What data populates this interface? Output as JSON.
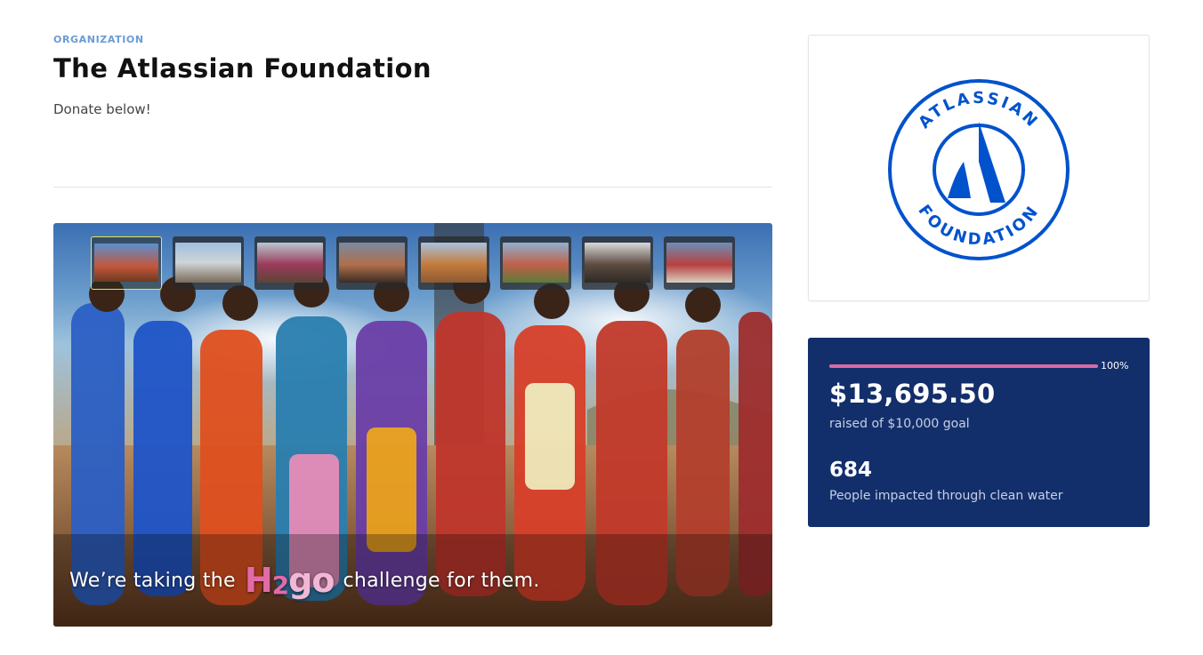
{
  "header": {
    "eyebrow": "ORGANIZATION",
    "title": "The Atlassian Foundation",
    "subtitle": "Donate below!"
  },
  "media": {
    "caption_prefix": "We’re taking the",
    "brand_h": "H",
    "brand_2": "2",
    "brand_g": "go",
    "caption_suffix": "challenge for them.",
    "thumbnails": [
      {
        "name": "video-1",
        "active": true
      },
      {
        "name": "video-2",
        "active": false
      },
      {
        "name": "video-3",
        "active": false
      },
      {
        "name": "video-4",
        "active": false
      },
      {
        "name": "video-5",
        "active": false
      },
      {
        "name": "video-6",
        "active": false
      },
      {
        "name": "video-7",
        "active": false
      },
      {
        "name": "video-8",
        "active": false
      }
    ]
  },
  "logo": {
    "top_text": "ATLASSIAN",
    "bottom_text": "FOUNDATION",
    "color": "#0052cc"
  },
  "stats": {
    "progress_fraction": 1.0,
    "progress_label": "100%",
    "amount_raised": "$13,695.50",
    "raised_label": "raised of $10,000 goal",
    "impact_count": "684",
    "impact_label": "People impacted through clean water",
    "colors": {
      "panel": "#132f6b",
      "progress": "#d96aa5"
    }
  }
}
